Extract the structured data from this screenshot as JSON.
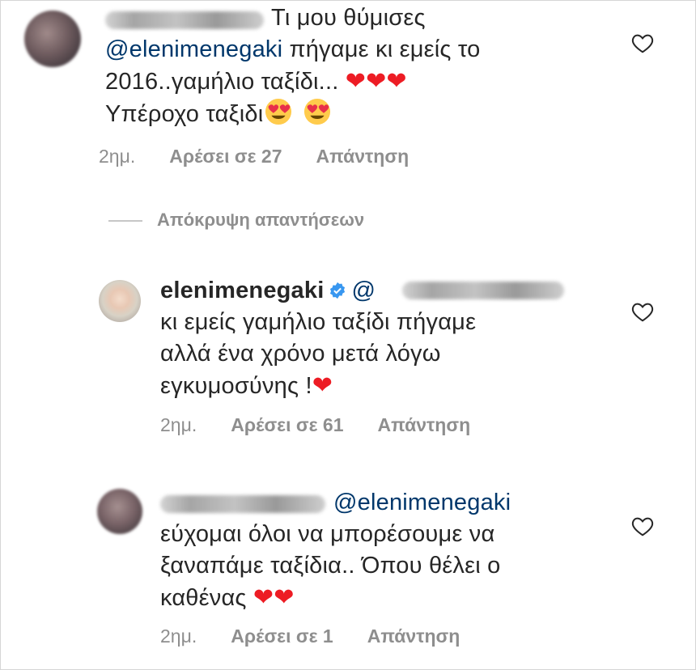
{
  "comments": [
    {
      "text_intro": "Τι μου θύμισες",
      "mention": "@elenimenegaki",
      "text_1": " πήγαμε κι εμείς το",
      "text_2": "2016..γαμήλιο ταξίδι...",
      "text_3": "Υπέροχο ταξιδι",
      "time": "2ημ.",
      "likes": "Αρέσει σε 27",
      "reply": "Απάντηση"
    },
    {
      "username": "elenimenegaki",
      "mention": "@",
      "text_1": "κι εμείς γαμήλιο ταξίδι πήγαμε",
      "text_2": "αλλά ένα χρόνο μετά λόγω",
      "text_3": "εγκυμοσύνης !",
      "time": "2ημ.",
      "likes": "Αρέσει σε 61",
      "reply": "Απάντηση"
    },
    {
      "mention": "@elenimenegaki",
      "text_1": "εύχομαι όλοι να μπορέσουμε να",
      "text_2": "ξαναπάμε ταξίδια.. Όπου θέλει ο",
      "text_3": "καθένας",
      "time": "2ημ.",
      "likes": "Αρέσει σε 1",
      "reply": "Απάντηση"
    }
  ],
  "hide_replies_label": "Απόκρυψη απαντήσεων",
  "heart_glyph": "❤",
  "icons": {
    "like": "heart-outline-icon",
    "verified": "verified-badge-icon",
    "emoji": "heart-eyes-emoji"
  },
  "colors": {
    "mention": "#00376b",
    "meta": "#8e8e8e",
    "heart": "#ed1c24",
    "verified": "#3897f0"
  }
}
